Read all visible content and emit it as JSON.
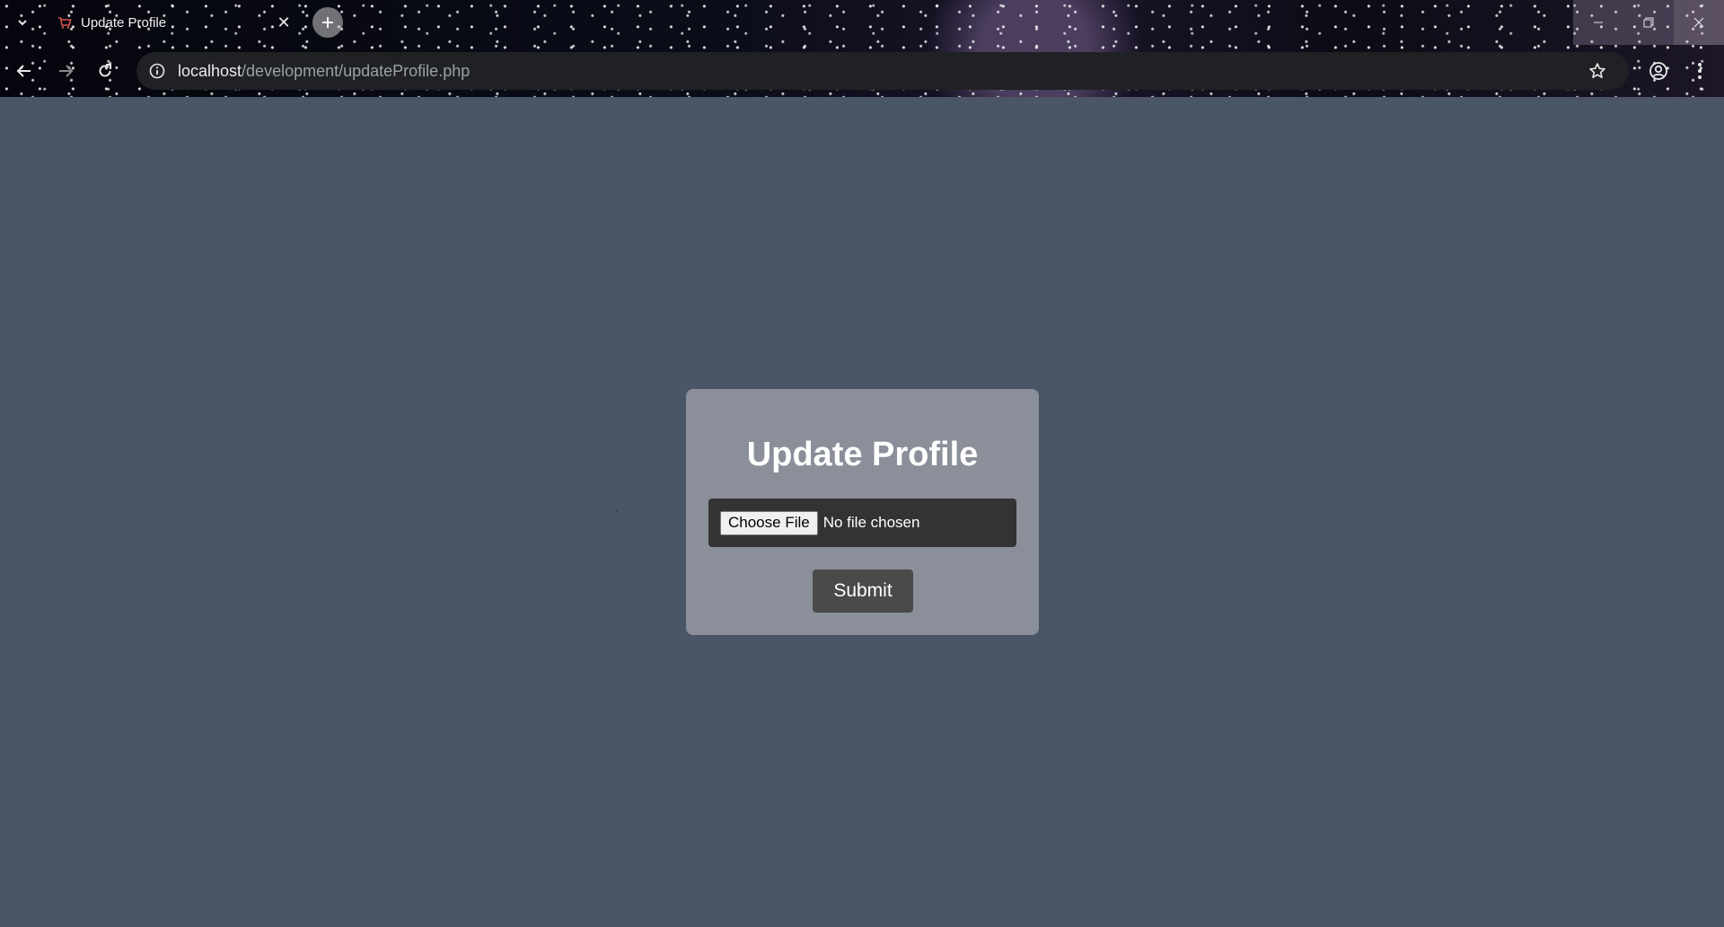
{
  "browser": {
    "tab": {
      "title": "Update Profile",
      "close_glyph": "✕"
    },
    "new_tab_glyph": "+",
    "url": {
      "host": "localhost",
      "path": "/development/updateProfile.php"
    },
    "icons": {
      "tab_list": "chevron-down-icon",
      "favicon": "shopping-cart-icon",
      "back": "arrow-left-icon",
      "forward": "arrow-right-icon",
      "reload": "reload-icon",
      "site_info": "info-icon",
      "bookmark": "star-icon",
      "profile": "account-circle-icon",
      "menu": "more-vertical-icon",
      "minimize": "minimize-icon",
      "restore": "restore-icon",
      "close": "close-icon"
    }
  },
  "page": {
    "form": {
      "title": "Update Profile",
      "choose_file_label": "Choose File",
      "file_status": "No file chosen",
      "submit_label": "Submit"
    }
  },
  "colors": {
    "page_background": "#4a5565",
    "card_background": "#8a8f99",
    "file_input_background": "#333333",
    "submit_background": "#4a4a4a",
    "omnibox_background": "#202124"
  }
}
